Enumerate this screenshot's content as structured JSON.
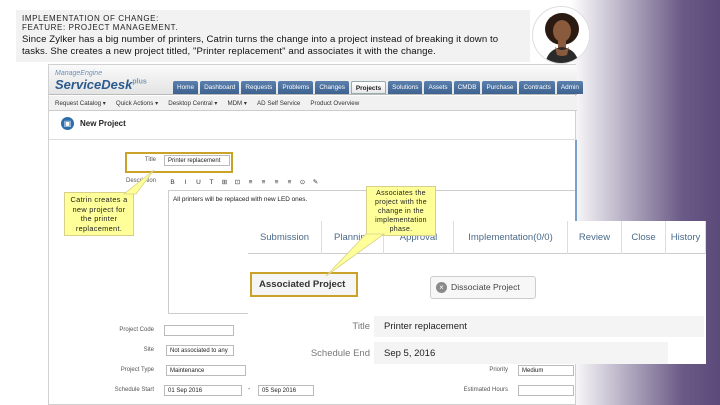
{
  "caption": {
    "header_line1": "IMPLEMENTATION OF CHANGE:",
    "header_line2": "FEATURE: PROJECT MANAGEMENT.",
    "body": "Since Zylker has a big number of printers, Catrin turns the change into a project instead of breaking it down to tasks. She creates a new project titled, \"Printer replacement\" and associates it with the change."
  },
  "app": {
    "logo_small": "ManageEngine",
    "logo_main": "ServiceDesk",
    "logo_sup": "plus",
    "tabs": [
      "Home",
      "Dashboard",
      "Requests",
      "Problems",
      "Changes",
      "Projects",
      "Solutions",
      "Assets",
      "CMDB",
      "Purchase",
      "Contracts",
      "Admin"
    ],
    "active_tab": "Projects",
    "toolbar": [
      "Request Catalog ▾",
      "Quick Actions ▾",
      "Desktop Central ▾",
      "MDM ▾",
      "AD Self Service",
      "Product Overview"
    ],
    "page_title": "New Project",
    "form": {
      "title_label": "Title",
      "title_value": "Printer replacement",
      "description_label": "Description",
      "description_text": "All printers will be replaced with new LED ones.",
      "project_code_label": "Project Code",
      "site_label": "Site",
      "site_value": "Not associated to any",
      "project_type_label": "Project Type",
      "project_type_value": "Maintenance",
      "schedule_start_label": "Schedule Start",
      "schedule_start_value": "01 Sep 2016",
      "schedule_end_value": "05 Sep 2016",
      "priority_label": "Priority",
      "priority_value": "Medium",
      "estimated_hours_label": "Estimated Hours"
    },
    "editor_buttons": [
      "B",
      "I",
      "U",
      "T",
      "⊞",
      "⊡",
      "≡",
      "≡",
      "≡",
      "≡",
      "⊙",
      "✎"
    ]
  },
  "callouts": {
    "left": "Catrin creates a new project for the printer replacement.",
    "right": "Associates the project with the change in the implementation phase."
  },
  "overlay": {
    "tabs": [
      "Submission",
      "Planning",
      "Approval",
      "Implementation(0/0)",
      "Review",
      "Close",
      "History"
    ],
    "associated_project": "Associated Project",
    "dissociate_button": "Dissociate Project",
    "title_label": "Title",
    "title_value": "Printer replacement",
    "schedule_end_label": "Schedule End",
    "schedule_end_value": "Sep 5, 2016"
  },
  "colors": {
    "highlight_border": "#c9a227",
    "callout_bg": "#ffff99",
    "tab_blue": "#3d628f"
  }
}
